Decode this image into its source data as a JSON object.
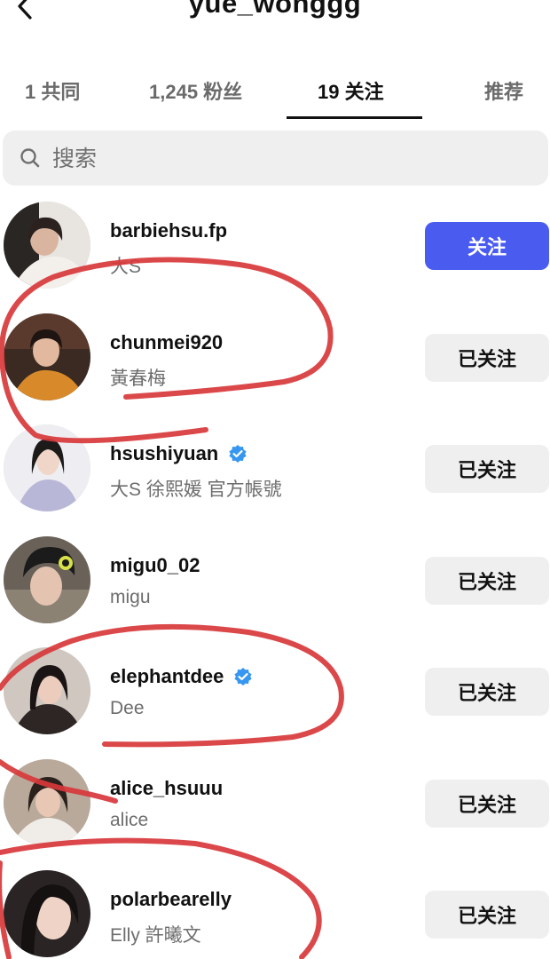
{
  "header": {
    "title": "yue_wonggg"
  },
  "tabs": [
    {
      "label": "1 共同"
    },
    {
      "label": "1,245 粉丝"
    },
    {
      "label": "19 关注"
    },
    {
      "label": "推荐"
    }
  ],
  "search": {
    "placeholder": "搜索"
  },
  "accounts": [
    {
      "username": "barbiehsu.fp",
      "name": "大S",
      "button": "关注",
      "verified": false
    },
    {
      "username": "chunmei920",
      "name": "黃春梅",
      "button": "已关注",
      "verified": false
    },
    {
      "username": "hsushiyuan",
      "name": "大S 徐熙媛 官方帳號",
      "button": "已关注",
      "verified": true
    },
    {
      "username": "migu0_02",
      "name": "migu",
      "button": "已关注",
      "verified": false
    },
    {
      "username": "elephantdee",
      "name": "Dee",
      "button": "已关注",
      "verified": true
    },
    {
      "username": "alice_hsuuu",
      "name": "alice",
      "button": "已关注",
      "verified": false
    },
    {
      "username": "polarbearelly",
      "name": "Elly 許曦文",
      "button": "已关注",
      "verified": false
    }
  ],
  "colors": {
    "follow_button": "#4a5cf0",
    "following_button": "#efefef",
    "verified_badge": "#3797f0",
    "annotation_marker": "#d8383b"
  },
  "icons": {
    "back": "chevron-left-icon",
    "search": "search-icon",
    "verified": "verified-badge-icon"
  }
}
